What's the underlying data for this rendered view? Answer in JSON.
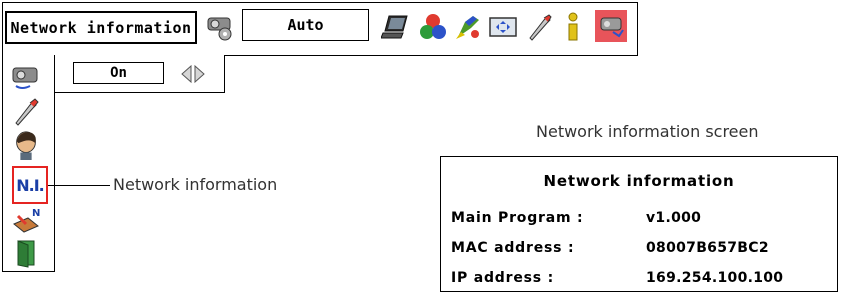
{
  "menu_bar": {
    "title": "Network information",
    "mode_value": "Auto",
    "icons": [
      "projector-settings-icon",
      "laptop-icon",
      "color-balls-icon",
      "color-brush-icon",
      "screen-icon",
      "wrench-icon",
      "info-icon",
      "network-icon"
    ]
  },
  "submenu": {
    "value": "On"
  },
  "sidebar": {
    "icons": [
      "network-projector-icon",
      "wrench-icon",
      "user-icon",
      "network-information-icon",
      "network-setting-icon",
      "exit-icon"
    ],
    "selected_label": "N.I."
  },
  "callout": {
    "label": "Network information"
  },
  "screen_caption": "Network information screen",
  "info_panel": {
    "title": "Network information",
    "rows": [
      {
        "label": "Main Program :",
        "value": "v1.000"
      },
      {
        "label": "MAC address :",
        "value": "08007B657BC2"
      },
      {
        "label": "IP address :",
        "value": "169.254.100.100"
      }
    ]
  },
  "colors": {
    "highlight_border": "#e52421",
    "ni_text": "#1b3fa6"
  }
}
